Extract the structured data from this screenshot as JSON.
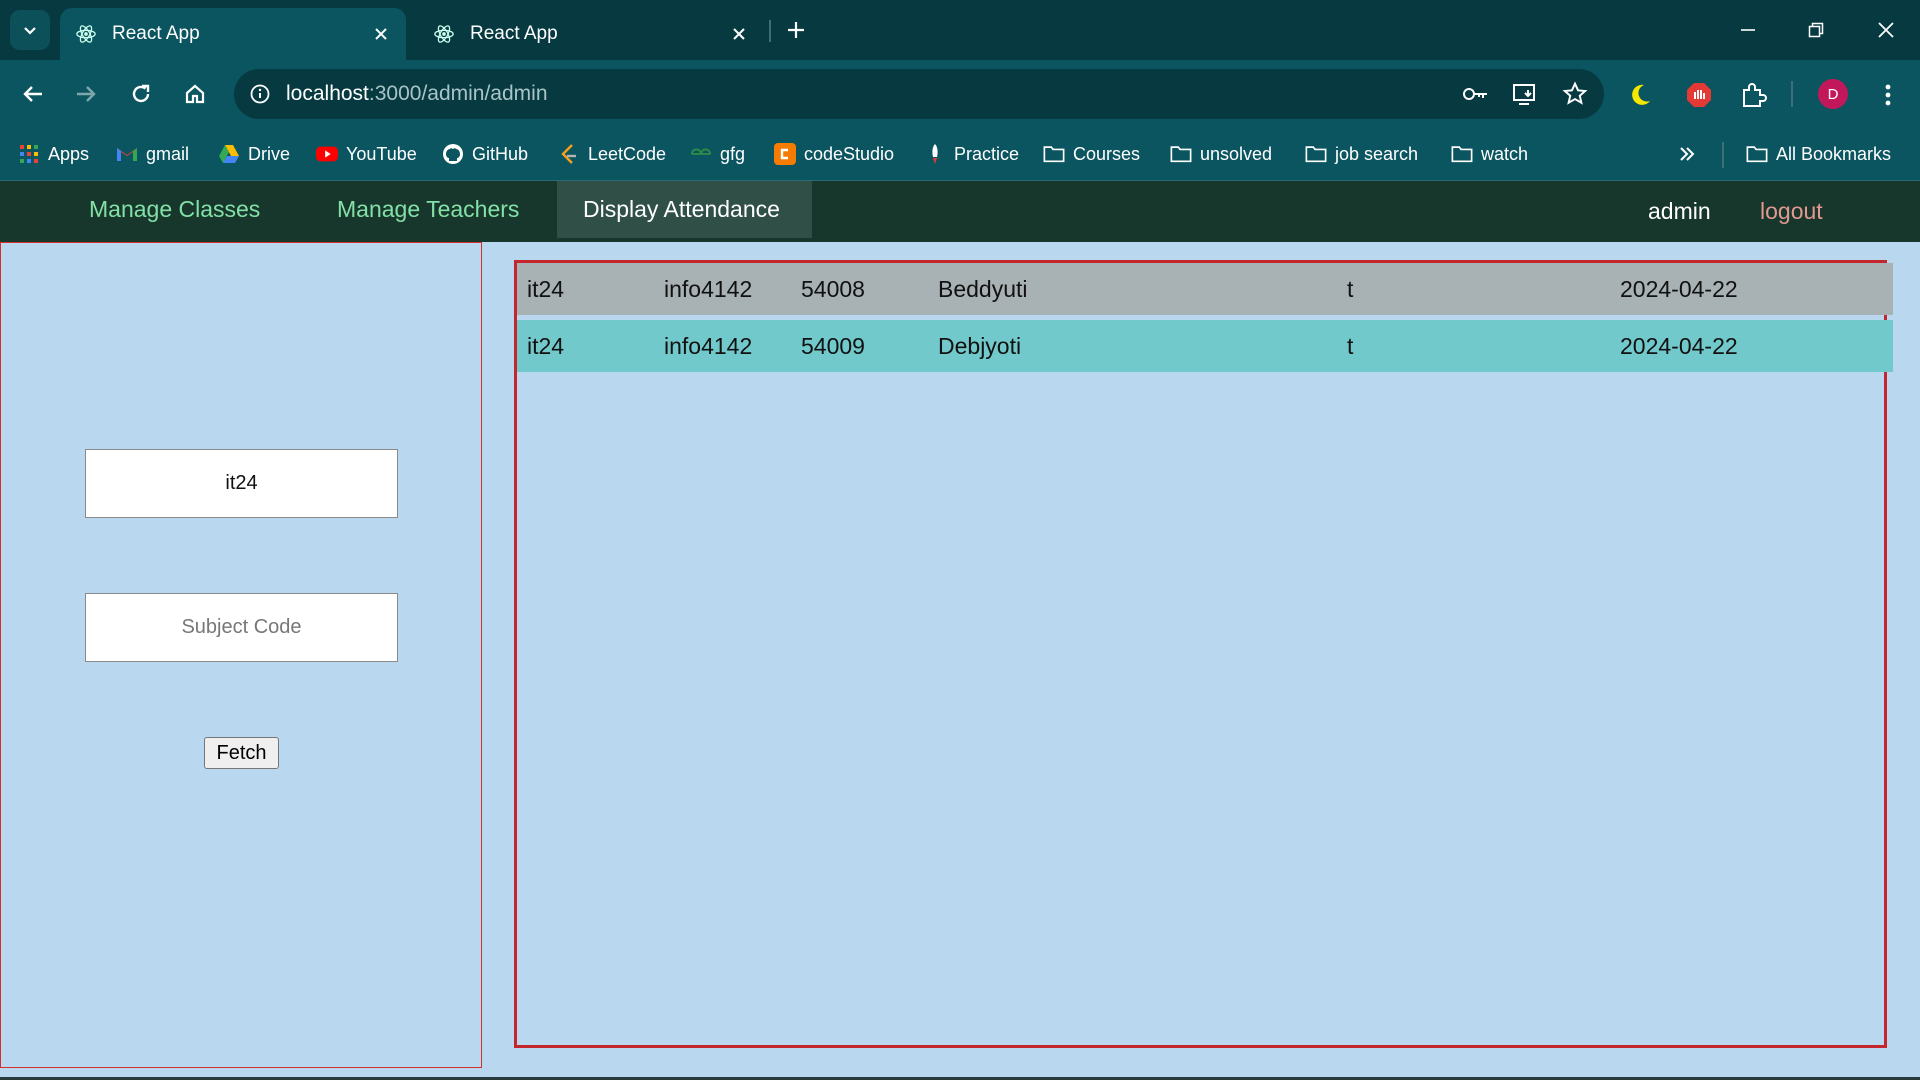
{
  "browser": {
    "tabs": [
      {
        "title": "React App",
        "active": true
      },
      {
        "title": "React App",
        "active": false
      }
    ],
    "url_host": "localhost",
    "url_rest": ":3000/admin/admin",
    "profile_initial": "D"
  },
  "bookmarks": [
    {
      "label": "Apps",
      "icon": "apps-grid-icon"
    },
    {
      "label": "gmail",
      "icon": "gmail-icon"
    },
    {
      "label": "Drive",
      "icon": "drive-icon"
    },
    {
      "label": "YouTube",
      "icon": "youtube-icon"
    },
    {
      "label": "GitHub",
      "icon": "github-icon"
    },
    {
      "label": "LeetCode",
      "icon": "leetcode-icon"
    },
    {
      "label": "gfg",
      "icon": "gfg-icon"
    },
    {
      "label": "codeStudio",
      "icon": "codestudio-icon"
    },
    {
      "label": "Practice",
      "icon": "practice-icon"
    },
    {
      "label": "Courses",
      "icon": "folder-icon"
    },
    {
      "label": "unsolved",
      "icon": "folder-icon"
    },
    {
      "label": "job search",
      "icon": "folder-icon"
    },
    {
      "label": "watch",
      "icon": "folder-icon"
    },
    {
      "label": "All Bookmarks",
      "icon": "folder-icon"
    }
  ],
  "navbar": {
    "links": [
      "Manage Classes",
      "Manage Teachers",
      "Display Attendance"
    ],
    "active": "Display Attendance",
    "user": "admin",
    "logout": "logout"
  },
  "form": {
    "class_value": "it24",
    "class_placeholder": "",
    "subject_value": "",
    "subject_placeholder": "Subject Code",
    "fetch_label": "Fetch"
  },
  "records": [
    [
      "it24",
      "info4142",
      "54008",
      "Beddyuti",
      "t",
      "2024-04-22"
    ],
    [
      "it24",
      "info4142",
      "54009",
      "Debjyoti",
      "t",
      "2024-04-22"
    ]
  ],
  "colors": {
    "page_bg": "#b9d7ef",
    "navbar_bg": "#17362c",
    "nav_link": "#83e0a6",
    "logout": "#e2998f",
    "row_odd": "#a8b1b3",
    "row_even": "#72c9cc",
    "panel_border": "#c4262e"
  }
}
